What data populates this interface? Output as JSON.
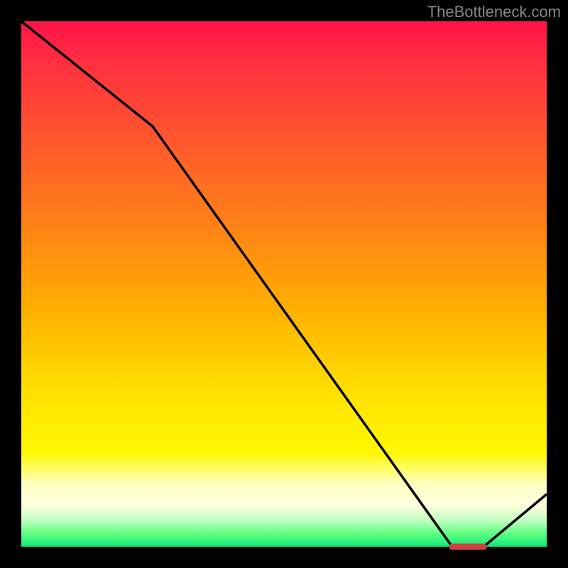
{
  "attribution": "TheBottleneck.com",
  "chart_data": {
    "type": "line",
    "title": "",
    "xlabel": "",
    "ylabel": "",
    "xlim": [
      0,
      100
    ],
    "ylim": [
      0,
      100
    ],
    "series": [
      {
        "name": "curve",
        "x": [
          0,
          25,
          82,
          88,
          100
        ],
        "y": [
          100,
          80,
          0,
          0,
          10
        ]
      }
    ],
    "markers": {
      "name": "highlight-band",
      "x": [
        82,
        83,
        84,
        85,
        86,
        87,
        88
      ],
      "y": [
        0,
        0,
        0,
        0,
        0,
        0,
        0
      ]
    },
    "gradient_stops": [
      {
        "pos": 0.0,
        "color": "#ff1448"
      },
      {
        "pos": 0.5,
        "color": "#ffb000"
      },
      {
        "pos": 0.9,
        "color": "#ffffc0"
      },
      {
        "pos": 1.0,
        "color": "#10e878"
      }
    ]
  }
}
